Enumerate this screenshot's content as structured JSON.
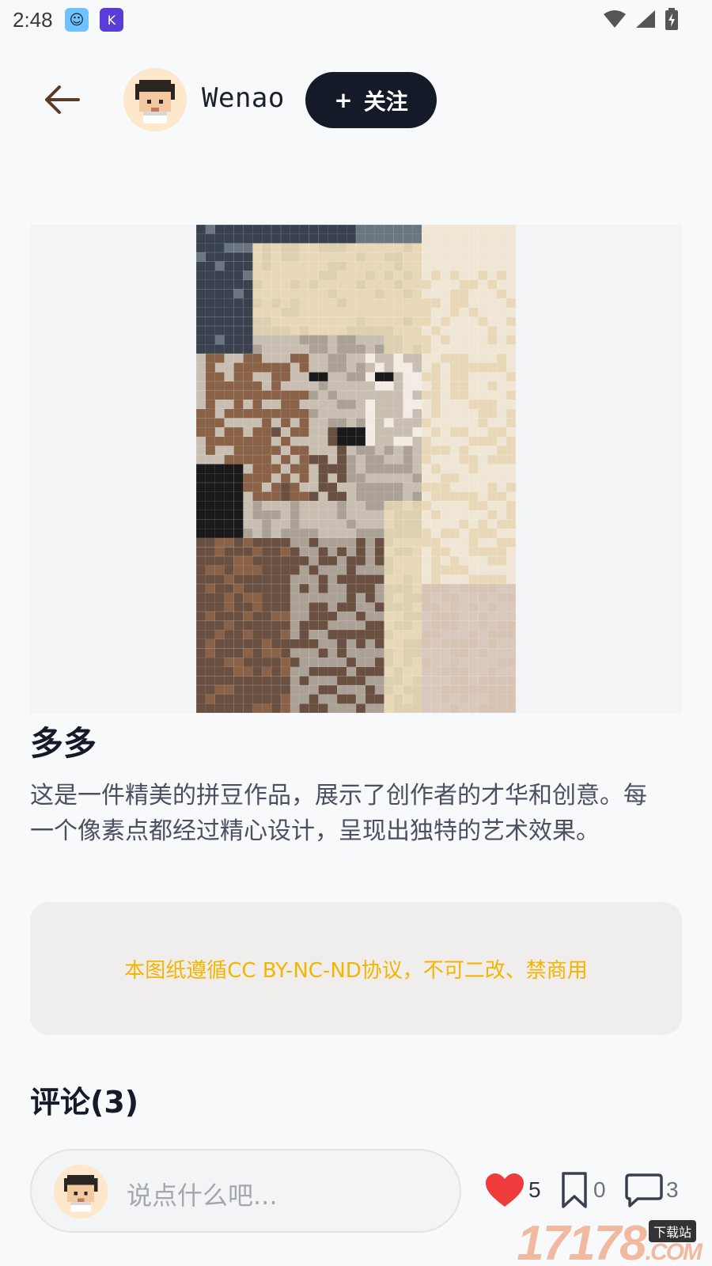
{
  "status_bar": {
    "time": "2:48",
    "icons": [
      "app-face-icon",
      "app-k-icon",
      "wifi-icon",
      "signal-icon",
      "battery-charging-icon"
    ]
  },
  "header": {
    "back_icon": "arrow-left-icon",
    "username": "Wenao",
    "follow_plus": "+",
    "follow_label": "关注"
  },
  "artwork": {
    "icon": "pixel-portrait-image"
  },
  "post": {
    "title": "多多",
    "description": "这是一件精美的拼豆作品，展示了创作者的才华和创意。每一个像素点都经过精心设计，呈现出独特的艺术效果。"
  },
  "license": {
    "text": "本图纸遵循CC BY-NC-ND协议，不可二改、禁商用",
    "color": "#f5b400"
  },
  "comments": {
    "header": "评论(3)"
  },
  "bottom_bar": {
    "placeholder": "说点什么吧...",
    "likes": "5",
    "bookmarks": "0",
    "comments": "3",
    "like_color": "#ef3b3b"
  },
  "watermark": {
    "main": "17178",
    "tag": "下载站",
    "suffix": ".COM"
  }
}
